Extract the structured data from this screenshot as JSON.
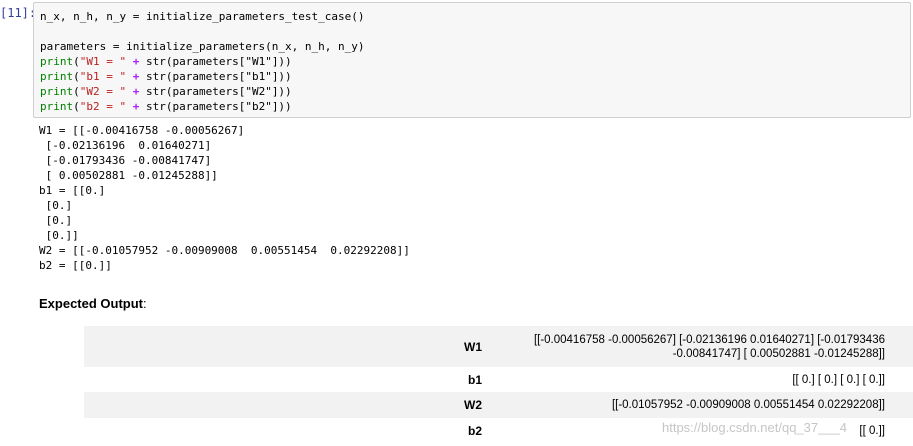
{
  "cell": {
    "prompt": "[11]:",
    "code": {
      "line1": "n_x, n_h, n_y = initialize_parameters_test_case()",
      "line2": "parameters = initialize_parameters(n_x, n_h, n_y)",
      "print_keyword": "print",
      "prints": [
        {
          "str_lit": "\"W1 = \"",
          "arg": "str(parameters[\"W1\"]))"
        },
        {
          "str_lit": "\"b1 = \"",
          "arg": "str(parameters[\"b1\"]))"
        },
        {
          "str_lit": "\"W2 = \"",
          "arg": "str(parameters[\"W2\"]))"
        },
        {
          "str_lit": "\"b2 = \"",
          "arg": "str(parameters[\"b2\"]))"
        }
      ]
    },
    "output_lines": [
      "W1 = [[-0.00416758 -0.00056267]",
      " [-0.02136196  0.01640271]",
      " [-0.01793436 -0.00841747]",
      " [ 0.00502881 -0.01245288]]",
      "b1 = [[0.]",
      " [0.]",
      " [0.]",
      " [0.]]",
      "W2 = [[-0.01057952 -0.00909008  0.00551454  0.02292208]]",
      "b2 = [[0.]]"
    ]
  },
  "expected": {
    "title": "Expected Output",
    "title_suffix": ":",
    "rows": [
      {
        "key": "W1",
        "value": "[[-0.00416758 -0.00056267] [-0.02136196 0.01640271] [-0.01793436 -0.00841747] [ 0.00502881 -0.01245288]]"
      },
      {
        "key": "b1",
        "value": "[[ 0.] [ 0.] [ 0.] [ 0.]]"
      },
      {
        "key": "W2",
        "value": "[[-0.01057952 -0.00909008 0.00551454 0.02292208]]"
      },
      {
        "key": "b2",
        "value": "[[ 0.]]"
      }
    ]
  },
  "watermark": "https://blog.csdn.net/qq_37___4"
}
